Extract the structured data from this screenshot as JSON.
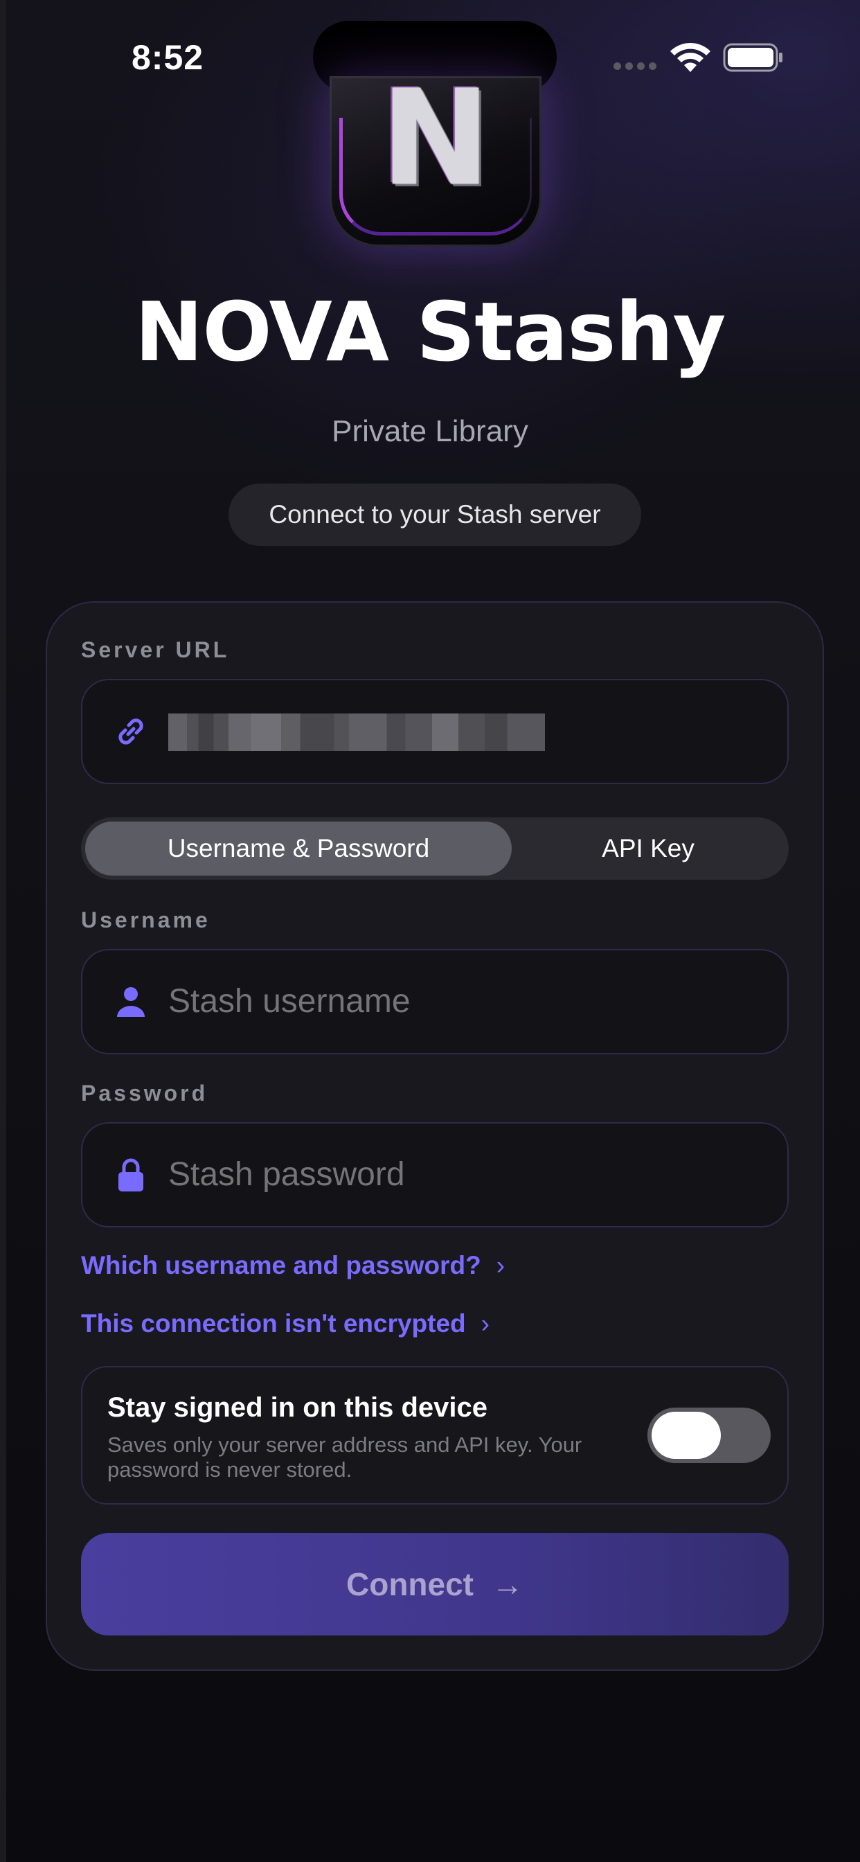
{
  "status_bar": {
    "time": "8:52"
  },
  "logo": {
    "letter": "N"
  },
  "header": {
    "title": "NOVA Stashy",
    "subtitle": "Private Library",
    "pill": "Connect to your Stash server"
  },
  "form": {
    "server_url": {
      "label": "Server URL"
    },
    "auth_modes": [
      {
        "label": "Username & Password",
        "selected": true
      },
      {
        "label": "API Key",
        "selected": false
      }
    ],
    "username": {
      "label": "Username",
      "placeholder": "Stash username"
    },
    "password": {
      "label": "Password",
      "placeholder": "Stash password"
    },
    "help_links": [
      {
        "label": "Which username and password?"
      },
      {
        "label": "This connection isn't encrypted"
      }
    ],
    "stay_signed_in": {
      "title": "Stay signed in on this device",
      "description": "Saves only your server address and API key. Your password is never stored.",
      "enabled": false
    },
    "connect_button": {
      "label": "Connect",
      "icon": "arrow-right-icon"
    }
  },
  "colors": {
    "accent": "#7a6bff",
    "button": "#4a3e9e",
    "card": "#18181e"
  }
}
